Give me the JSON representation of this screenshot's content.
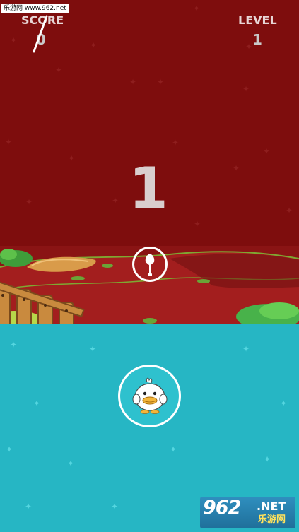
{
  "hud": {
    "score_label": "SCORE",
    "score_value": "0",
    "level_label": "LEVEL",
    "level_value": "1"
  },
  "countdown": "1",
  "watermarks": {
    "top_text": "乐游网 www.962.net",
    "logo_number": "962",
    "logo_suffix": ".NET",
    "logo_cn": "乐游网"
  },
  "icons": {
    "shovel_button": "shovel-icon",
    "duck_button": "duck-icon"
  },
  "colors": {
    "sky_dark_red": "#7e0d0d",
    "water_teal": "#26b6c4",
    "hud_text": "#e8d6d6"
  }
}
